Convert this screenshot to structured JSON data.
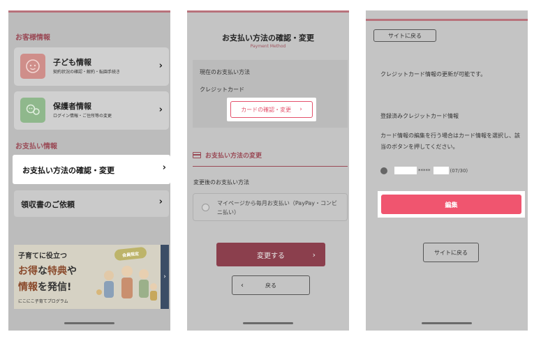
{
  "panel1": {
    "section_customer": "お客様情報",
    "children": {
      "title": "子ども情報",
      "subtitle": "契約状況の確認・解約・転園手続き"
    },
    "guardian": {
      "title": "保護者情報",
      "subtitle": "ログイン情報・ご住所等の変更"
    },
    "section_payment": "お支払い情報",
    "payment_method": "お支払い方法の確認・変更",
    "receipt": "領収書のご依頼",
    "banner": {
      "line1": "子育てに役立つ",
      "line2_a": "お得",
      "line2_b": "な",
      "line2_c": "特典",
      "line2_d": "や",
      "line3_a": "情報",
      "line3_b": "を発信!",
      "badge": "会員限定",
      "logo": "にこにこ子育てプログラム"
    },
    "chevron": "›"
  },
  "panel2": {
    "title": "お支払い方法の確認・変更",
    "subtitle": "Payment Method",
    "current_label": "現在のお支払い方法",
    "current_value": "クレジットカード",
    "check_card_button": "カードの確認・変更",
    "change_section": "お支払い方法の変更",
    "after_label": "変更後のお支払い方法",
    "option_text": "マイページから毎月お支払い（PayPay・コンビニ払い）",
    "submit_button": "変更する",
    "back_button": "戻る",
    "chevron_right": "›",
    "chevron_left": "‹"
  },
  "panel3": {
    "top_back": "サイトに戻る",
    "info": "クレジットカード情報の更新が可能です。",
    "registered_label": "登録済みクレジットカード情報",
    "instructions": "カード情報の編集を行う場合はカード情報を選択し、該当のボタンを押してください。",
    "card_mask": "*****",
    "card_expiry": "(07/30)",
    "edit_button": "編集",
    "bottom_back": "サイトに戻る"
  },
  "colors": {
    "accent_pink": "#f0556f",
    "dim_accent": "#9a4a56",
    "submit_dim": "#8b3f4d"
  }
}
